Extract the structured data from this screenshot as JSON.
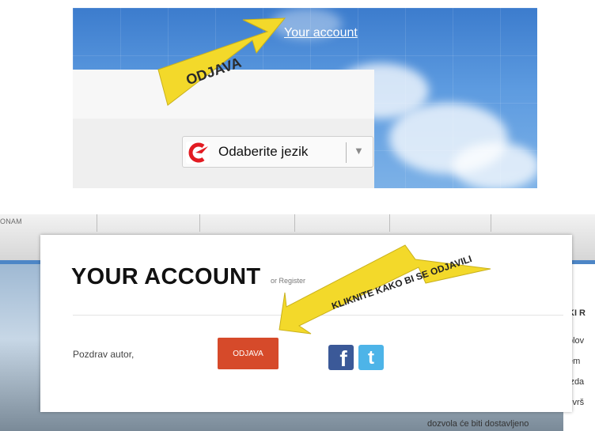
{
  "top_panel": {
    "account_link": "Your account",
    "arrow_label": "ODJAVA",
    "language_selector": {
      "label": "Odaberite jezik",
      "caret_icon": "caret-down-icon",
      "logo_icon": "translate-logo-icon"
    }
  },
  "bottom_panel": {
    "nav_fragment": "ONAM",
    "modal": {
      "title": "YOUR ACCOUNT",
      "register_link": "or Register",
      "greeting": "Pozdrav autor,",
      "logout_button": "ODJAVA",
      "social": {
        "facebook_icon": "facebook-icon",
        "twitter_icon": "twitter-icon"
      }
    },
    "arrow_label": "KLIKNITE KAKO BI SE ODJAVILI",
    "background_text": {
      "heading": "KI R",
      "line1": "olov",
      "line2": "em",
      "line3": "izda",
      "line4": "zvrš",
      "bottom": "dozvola će biti dostavljeno"
    }
  },
  "colors": {
    "arrow_yellow": "#f3d92a",
    "logout_red": "#d64a2a",
    "facebook_blue": "#3b5998",
    "twitter_blue": "#4db4e8",
    "sky_blue": "#5d9be0"
  }
}
